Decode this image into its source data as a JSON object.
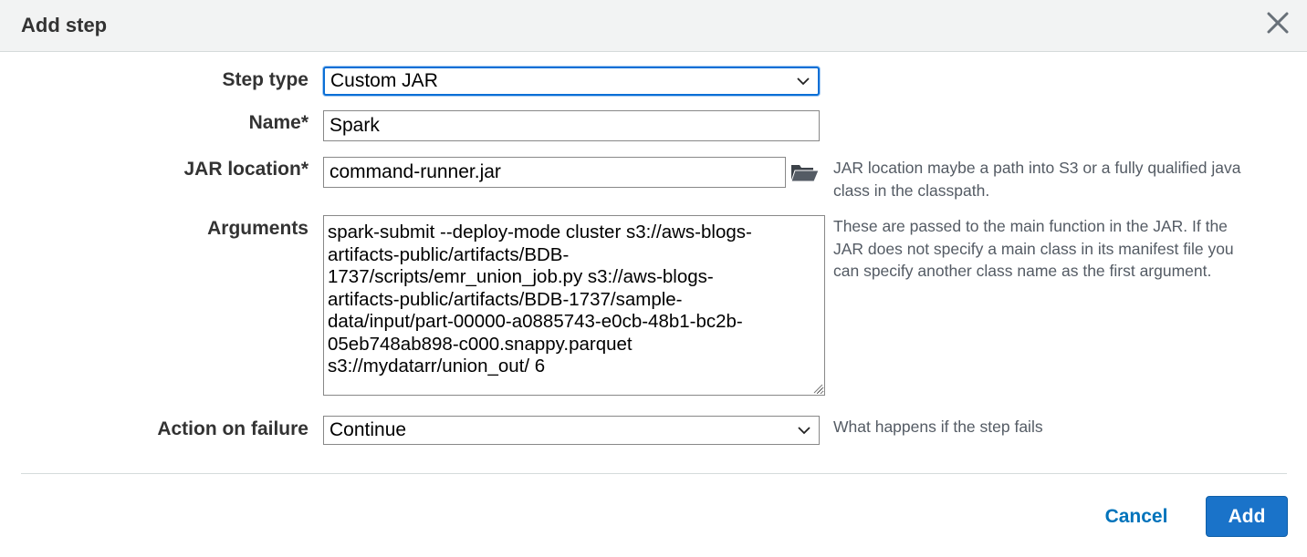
{
  "dialog": {
    "title": "Add step",
    "close_icon": "close-icon"
  },
  "form": {
    "step_type": {
      "label": "Step type",
      "value": "Custom JAR"
    },
    "name": {
      "label": "Name*",
      "value": "Spark"
    },
    "jar_location": {
      "label": "JAR location*",
      "value": "command-runner.jar",
      "browse_icon": "folder-icon",
      "help_lines": [
        "JAR location maybe a path into S3 or a fully qualified java",
        "class in the classpath."
      ]
    },
    "arguments": {
      "label": "Arguments",
      "value_lines": [
        "spark-submit --deploy-mode cluster s3://aws-blogs-",
        "artifacts-public/artifacts/BDB-",
        "1737/scripts/emr_union_job.py s3://aws-blogs-",
        "artifacts-public/artifacts/BDB-1737/sample-",
        "data/input/part-00000-a0885743-e0cb-48b1-bc2b-",
        "05eb748ab898-c000.snappy.parquet",
        "s3://mydatarr/union_out/ 6"
      ],
      "help_lines": [
        "These are passed to the main function in the JAR. If the",
        "JAR does not specify a main class in its manifest file you",
        "can specify another class name as the first argument."
      ]
    },
    "action_on_failure": {
      "label": "Action on failure",
      "value": "Continue",
      "help": "What happens if the step fails"
    }
  },
  "footer": {
    "cancel_label": "Cancel",
    "add_label": "Add"
  },
  "colors": {
    "header_bg": "#f2f3f3",
    "link_blue": "#0073bb",
    "primary_button": "#1a73c9",
    "focus_border": "#0a6fd6"
  }
}
